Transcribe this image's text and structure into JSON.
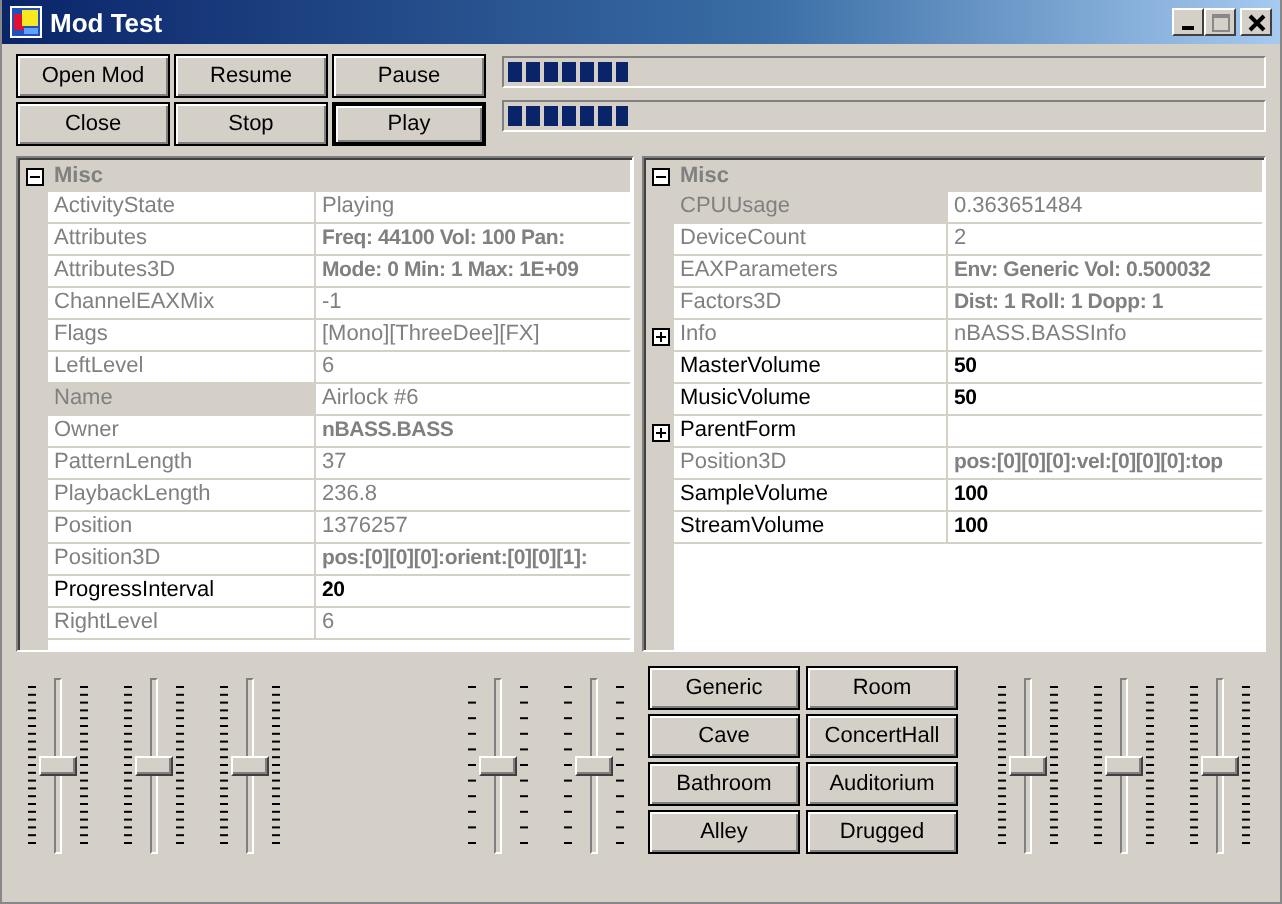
{
  "window": {
    "title": "Mod Test"
  },
  "buttons": [
    {
      "label": "Open Mod",
      "default": false
    },
    {
      "label": "Resume",
      "default": false
    },
    {
      "label": "Pause",
      "default": false
    },
    {
      "label": "Close",
      "default": false
    },
    {
      "label": "Stop",
      "default": false
    },
    {
      "label": "Play",
      "default": true
    }
  ],
  "progress_bars": [
    {
      "level": 0.16
    },
    {
      "level": 0.16
    }
  ],
  "property_grids": [
    {
      "category": "Misc",
      "expanded": true,
      "rows": [
        {
          "name": "ActivityState",
          "value": "Playing",
          "readonly": true,
          "bold": false,
          "selected": false
        },
        {
          "name": "Attributes",
          "value": "Freq: 44100 Vol: 100 Pan:",
          "readonly": true,
          "bold": true,
          "selected": false
        },
        {
          "name": "Attributes3D",
          "value": "Mode: 0 Min: 1 Max: 1E+09",
          "readonly": true,
          "bold": true,
          "selected": false
        },
        {
          "name": "ChannelEAXMix",
          "value": "-1",
          "readonly": true,
          "bold": false,
          "selected": false
        },
        {
          "name": "Flags",
          "value": "[Mono][ThreeDee][FX]",
          "readonly": true,
          "bold": false,
          "selected": false
        },
        {
          "name": "LeftLevel",
          "value": "6",
          "readonly": true,
          "bold": false,
          "selected": false
        },
        {
          "name": "Name",
          "value": "Airlock #6",
          "readonly": true,
          "bold": false,
          "selected": true
        },
        {
          "name": "Owner",
          "value": "nBASS.BASS",
          "readonly": true,
          "bold": true,
          "selected": false
        },
        {
          "name": "PatternLength",
          "value": "37",
          "readonly": true,
          "bold": false,
          "selected": false
        },
        {
          "name": "PlaybackLength",
          "value": "236.8",
          "readonly": true,
          "bold": false,
          "selected": false
        },
        {
          "name": "Position",
          "value": "1376257",
          "readonly": true,
          "bold": false,
          "selected": false
        },
        {
          "name": "Position3D",
          "value": "pos:[0][0][0]:orient:[0][0][1]:",
          "readonly": true,
          "bold": true,
          "selected": false
        },
        {
          "name": "ProgressInterval",
          "value": "20",
          "readonly": false,
          "bold": true,
          "selected": false
        },
        {
          "name": "RightLevel",
          "value": "6",
          "readonly": true,
          "bold": false,
          "selected": false
        }
      ]
    },
    {
      "category": "Misc",
      "expanded": true,
      "rows": [
        {
          "name": "CPUUsage",
          "value": "0.363651484",
          "readonly": true,
          "bold": false,
          "selected": true
        },
        {
          "name": "DeviceCount",
          "value": "2",
          "readonly": true,
          "bold": false,
          "selected": false
        },
        {
          "name": "EAXParameters",
          "value": "Env: Generic Vol: 0.500032",
          "readonly": true,
          "bold": true,
          "selected": false
        },
        {
          "name": "Factors3D",
          "value": "Dist: 1 Roll: 1 Dopp: 1",
          "readonly": true,
          "bold": true,
          "selected": false
        },
        {
          "name": "Info",
          "value": "nBASS.BASSInfo",
          "readonly": true,
          "bold": false,
          "selected": false,
          "expanded": false
        },
        {
          "name": "MasterVolume",
          "value": "50",
          "readonly": false,
          "bold": true,
          "selected": false
        },
        {
          "name": "MusicVolume",
          "value": "50",
          "readonly": false,
          "bold": true,
          "selected": false
        },
        {
          "name": "ParentForm",
          "readonly": false,
          "selected": false,
          "expanded": false
        },
        {
          "name": "Position3D",
          "value": "pos:[0][0][0]:vel:[0][0][0]:top",
          "readonly": true,
          "bold": true,
          "selected": false
        },
        {
          "name": "SampleVolume",
          "value": "100",
          "readonly": false,
          "bold": true,
          "selected": false
        },
        {
          "name": "StreamVolume",
          "value": "100",
          "readonly": false,
          "bold": true,
          "selected": false
        }
      ]
    }
  ],
  "sliders_left": [
    {
      "kind": "fine",
      "level": 0.5
    },
    {
      "kind": "fine",
      "level": 0.5
    },
    {
      "kind": "fine",
      "level": 0.5
    }
  ],
  "sliders_middle": [
    {
      "kind": "coarse",
      "level": 0.5
    },
    {
      "kind": "coarse",
      "level": 0.5
    }
  ],
  "eax_buttons": [
    "Generic",
    "Room",
    "Cave",
    "ConcertHall",
    "Bathroom",
    "Auditorium",
    "Alley",
    "Drugged"
  ],
  "sliders_right": [
    {
      "kind": "fine",
      "level": 0.5
    },
    {
      "kind": "fine",
      "level": 0.5
    },
    {
      "kind": "fine",
      "level": 0.5
    }
  ]
}
